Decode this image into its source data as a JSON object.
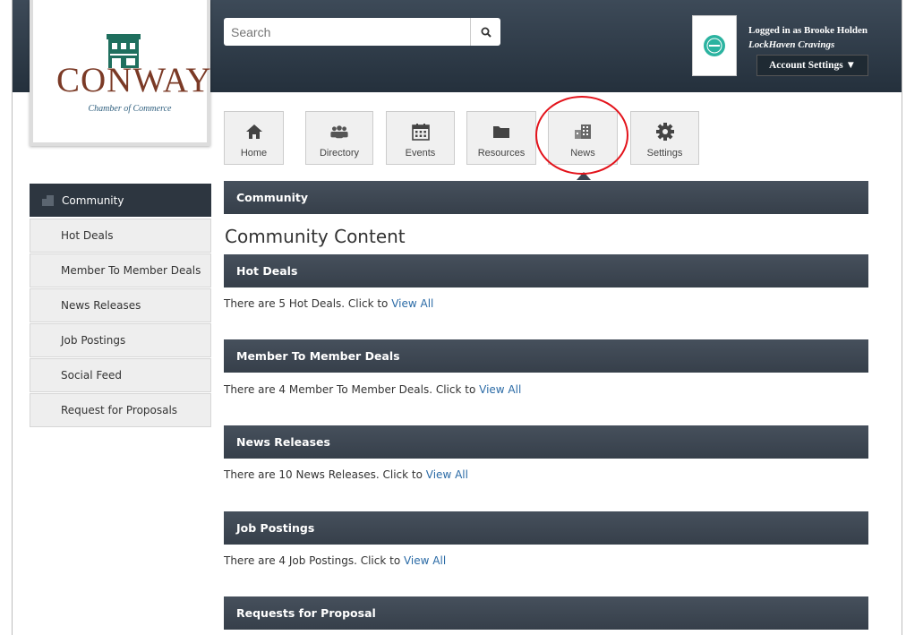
{
  "header": {
    "logo": {
      "text": "CONWAY",
      "subtitle": "Chamber of Commerce"
    },
    "search": {
      "placeholder": "Search",
      "icon": "search-icon"
    },
    "user": {
      "logged_in_text": "Logged in as Brooke Holden",
      "business": "LockHaven Cravings",
      "account_settings_label": "Account Settings ▼"
    }
  },
  "nav": [
    {
      "label": "Home",
      "icon": "home-icon"
    },
    {
      "label": "Directory",
      "icon": "people-icon"
    },
    {
      "label": "Events",
      "icon": "calendar-icon"
    },
    {
      "label": "Resources",
      "icon": "folder-icon"
    },
    {
      "label": "News",
      "icon": "building-icon"
    },
    {
      "label": "Settings",
      "icon": "gear-icon"
    }
  ],
  "sidebar": {
    "heading": "Community",
    "items": [
      {
        "label": "Hot Deals"
      },
      {
        "label": "Member To Member Deals"
      },
      {
        "label": "News Releases"
      },
      {
        "label": "Job Postings"
      },
      {
        "label": "Social Feed"
      },
      {
        "label": "Request for Proposals"
      }
    ]
  },
  "main": {
    "section_title": "Community",
    "content_title": "Community Content",
    "sections": [
      {
        "title": "Hot Deals",
        "text": "There are 5 Hot Deals. Click to ",
        "link": "View All"
      },
      {
        "title": "Member To Member Deals",
        "text": "There are 4 Member To Member Deals. Click to ",
        "link": "View All"
      },
      {
        "title": "News Releases",
        "text": "There are 10 News Releases. Click to ",
        "link": "View All"
      },
      {
        "title": "Job Postings",
        "text": "There are 4 Job Postings. Click to ",
        "link": "View All"
      },
      {
        "title": "Requests for Proposal",
        "text": "",
        "link": ""
      }
    ]
  },
  "colors": {
    "header_dark": "#2b3642",
    "link": "#2b6ba6",
    "highlight_circle": "#e3131b"
  }
}
